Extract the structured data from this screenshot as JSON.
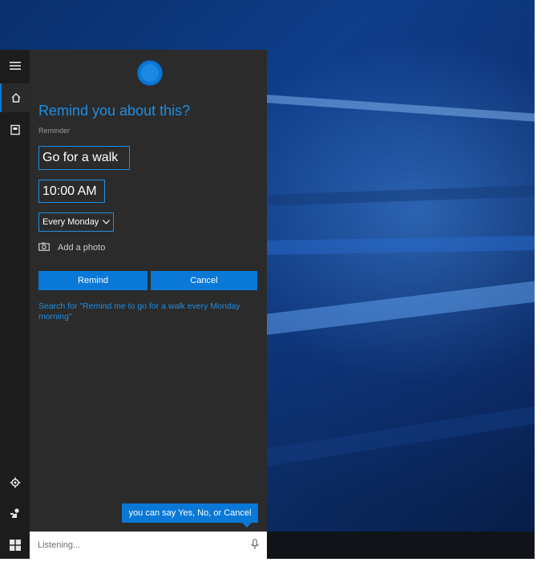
{
  "colors": {
    "accent": "#0a78d7",
    "panel_bg": "#2b2b2b",
    "rail_bg": "#1c1c1c",
    "heading": "#1e8fe5"
  },
  "rail": {
    "items": [
      {
        "icon": "hamburger-menu-icon"
      },
      {
        "icon": "home-icon",
        "active": true
      },
      {
        "icon": "notebook-icon"
      },
      {
        "icon": "settings-gear-icon"
      },
      {
        "icon": "feedback-person-icon"
      },
      {
        "icon": "windows-start-icon"
      }
    ]
  },
  "cortana": {
    "heading": "Remind you about this?",
    "reminder_label": "Reminder",
    "reminder_value": "Go for a walk",
    "time_value": "10:00 AM",
    "repeat_value": "Every Monday",
    "add_photo_label": "Add a photo",
    "remind_button": "Remind",
    "cancel_button": "Cancel",
    "search_suggestion": "Search for \"Remind me to go for a walk every Monday morning\"",
    "hint_bubble": "you can say Yes, No, or Cancel"
  },
  "searchbar": {
    "status": "Listening...",
    "mic_icon": "microphone-icon"
  }
}
